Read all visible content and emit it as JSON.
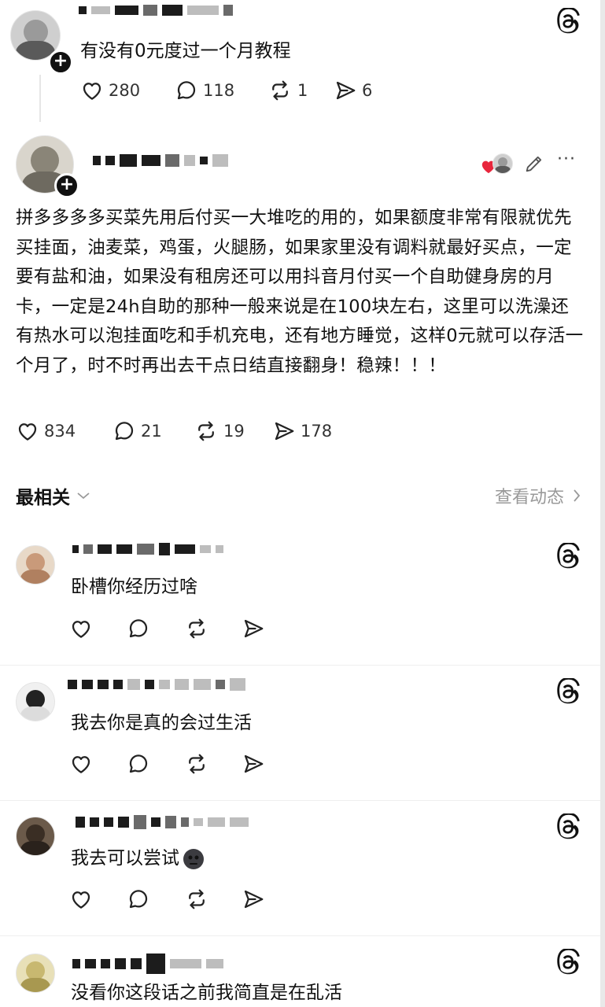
{
  "top_post": {
    "text": "有没有0元度过一个月教程",
    "likes": "280",
    "comments": "118",
    "reposts": "1",
    "shares": "6"
  },
  "main_post": {
    "body": "拼多多多多买菜先用后付买一大堆吃的用的，如果额度非常有限就优先买挂面，油麦菜，鸡蛋，火腿肠，如果家里没有调料就最好买点，一定要有盐和油，如果没有租房还可以用抖音月付买一个自助健身房的月卡，一定是24h自助的那种一般来说是在100块左右，这里可以洗澡还有热水可以泡挂面吃和手机充电，还有地方睡觉，这样0元就可以存活一个月了，时不时再出去干点日结直接翻身！稳辣！！！",
    "likes": "834",
    "comments": "21",
    "reposts": "19",
    "shares": "178",
    "more_label": "···"
  },
  "section": {
    "title": "最相关",
    "view_activity": "查看动态"
  },
  "comments": [
    {
      "text": "卧槽你经历过啥"
    },
    {
      "text": "我去你是真的会过生活"
    },
    {
      "text": "我去可以尝试"
    },
    {
      "text": "没看你这段话之前我简直是在乱活"
    }
  ],
  "icons": {
    "threads": "threads-icon",
    "like": "heart-icon",
    "comment": "comment-icon",
    "repost": "repost-icon",
    "share": "send-icon",
    "edit": "pencil-icon",
    "more": "more-icon"
  },
  "colors": {
    "heart_red": "#e8263c",
    "text": "#111111",
    "muted": "#999999"
  }
}
